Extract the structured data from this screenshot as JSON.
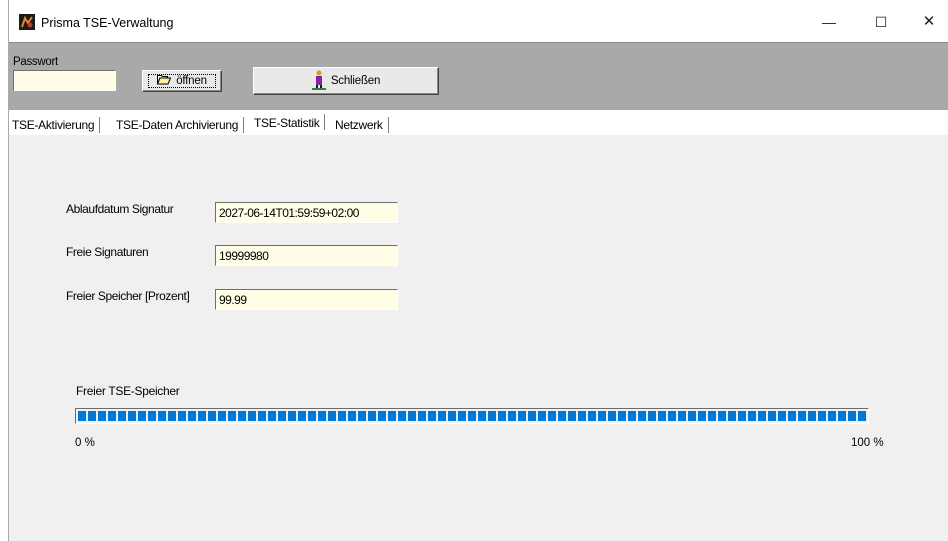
{
  "window": {
    "title": "Prisma TSE-Verwaltung",
    "controls": {
      "minimize": "—",
      "maximize": "☐",
      "close": "✕"
    }
  },
  "toolbar": {
    "password_label": "Passwort",
    "password_value": "",
    "open_button": "öffnen",
    "close_button": "Schließen"
  },
  "tabs": [
    {
      "label": "TSE-Aktivierung",
      "active": false
    },
    {
      "label": "TSE-Daten Archivierung",
      "active": false
    },
    {
      "label": "TSE-Statistik",
      "active": true
    },
    {
      "label": "Netzwerk",
      "active": false
    }
  ],
  "stats": {
    "expiry_label": "Ablaufdatum Signatur",
    "expiry_value": "2027-06-14T01:59:59+02:00",
    "free_sig_label": "Freie Signaturen",
    "free_sig_value": "19999980",
    "free_mem_label": "Freier Speicher [Prozent]",
    "free_mem_value": "99.99"
  },
  "progress": {
    "label": "Freier TSE-Speicher",
    "min_label": "0 %",
    "max_label": "100 %",
    "percent": 99.99,
    "color": "#0078d7"
  },
  "icons": {
    "app": "prisma-app-icon",
    "open": "folder-open-icon",
    "close": "exit-door-icon"
  }
}
